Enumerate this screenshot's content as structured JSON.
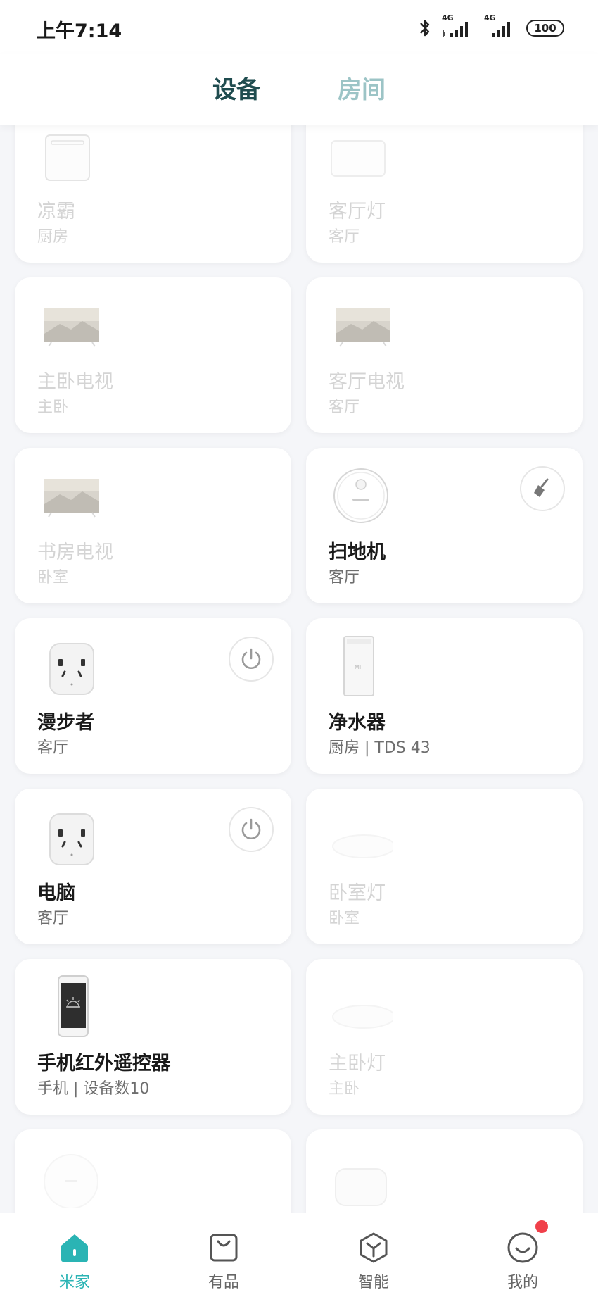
{
  "status_bar": {
    "time": "上午7:14",
    "network1": "4G",
    "network2": "4G",
    "battery": "100"
  },
  "header": {
    "tabs": [
      {
        "label": "设备",
        "active": true
      },
      {
        "label": "房间",
        "active": false
      }
    ]
  },
  "devices": [
    {
      "name": "凉霸",
      "room": "厨房",
      "status": "offline",
      "icon": "bath-heater-icon"
    },
    {
      "name": "客厅灯",
      "room": "客厅",
      "status": "offline",
      "icon": "panel-light-icon"
    },
    {
      "name": "主卧电视",
      "room": "主卧",
      "status": "offline",
      "icon": "tv-icon"
    },
    {
      "name": "客厅电视",
      "room": "客厅",
      "status": "offline",
      "icon": "tv-icon"
    },
    {
      "name": "书房电视",
      "room": "卧室",
      "status": "offline",
      "icon": "tv-icon"
    },
    {
      "name": "扫地机",
      "room": "客厅",
      "status": "online",
      "icon": "robot-vacuum-icon",
      "action": "broom-icon"
    },
    {
      "name": "漫步者",
      "room": "客厅",
      "status": "online",
      "icon": "smart-plug-icon",
      "action": "power-icon"
    },
    {
      "name": "净水器",
      "room": "厨房 | TDS 43",
      "status": "online",
      "icon": "water-purifier-icon"
    },
    {
      "name": "电脑",
      "room": "客厅",
      "status": "online",
      "icon": "smart-plug-icon",
      "action": "power-icon"
    },
    {
      "name": "卧室灯",
      "room": "卧室",
      "status": "offline",
      "icon": "ceiling-light-icon"
    },
    {
      "name": "手机红外遥控器",
      "room": "手机 | 设备数10",
      "status": "online",
      "icon": "phone-remote-icon"
    },
    {
      "name": "主卧灯",
      "room": "主卧",
      "status": "offline",
      "icon": "ceiling-light-icon"
    }
  ],
  "bottom_nav": [
    {
      "label": "米家",
      "icon": "home-icon",
      "active": true
    },
    {
      "label": "有品",
      "icon": "shopping-bag-icon",
      "active": false
    },
    {
      "label": "智能",
      "icon": "automation-icon",
      "active": false
    },
    {
      "label": "我的",
      "icon": "profile-icon",
      "active": false,
      "badge": true
    }
  ],
  "colors": {
    "accent": "#2ab4b4",
    "tab_active": "#1f4c4f",
    "tab_inactive": "#9cc4c6",
    "badge": "#f0404a"
  }
}
